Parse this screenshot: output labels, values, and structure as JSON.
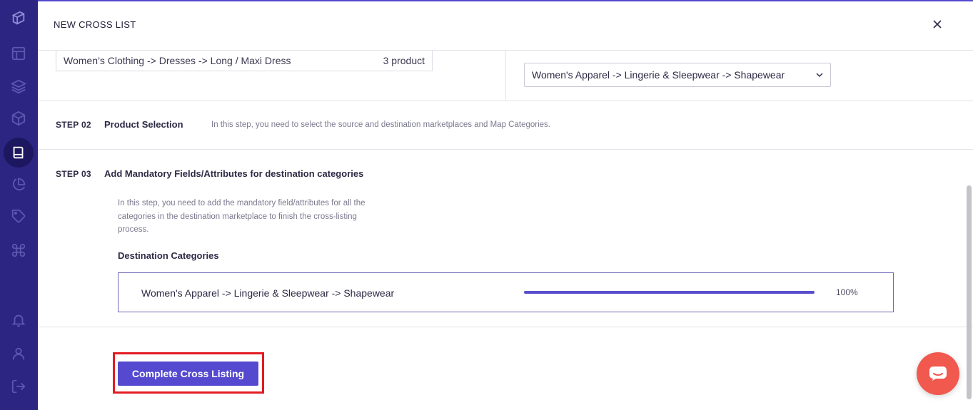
{
  "colors": {
    "sidebar": "#2c2582",
    "accent": "#5449cf",
    "highlight": "#e31b23",
    "chat": "#f1584e"
  },
  "sidebar": {
    "icons": [
      "logo-icon",
      "layout-icon",
      "layers-icon",
      "box-icon",
      "book-icon",
      "pie-chart-icon",
      "tag-icon",
      "command-icon",
      "bell-icon",
      "user-icon",
      "logout-icon"
    ],
    "active": "book-icon"
  },
  "header": {
    "title": "NEW CROSS LIST",
    "close_icon": "close-icon"
  },
  "step1": {
    "source_category": "Women’s Clothing -> Dresses -> Long / Maxi Dress",
    "source_count": "3 product",
    "destination_selected": "Women's Apparel -> Lingerie & Sleepwear -> Shapewear"
  },
  "step2": {
    "number": "STEP 02",
    "title": "Product Selection",
    "description": "In this step, you need to select the source and destination marketplaces and Map Categories."
  },
  "step3": {
    "number": "STEP 03",
    "title": "Add Mandatory Fields/Attributes for destination categories",
    "description_lines": [
      "In this step, you need to add the mandatory field/attributes for all the",
      "categories in the destination marketplace to finish the cross-listing",
      "process."
    ],
    "destination_label": "Destination Categories",
    "destination_category": "Women's Apparel -> Lingerie & Sleepwear -> Shapewear",
    "progress_percent": 100,
    "progress_label": "100%"
  },
  "actions": {
    "complete_label": "Complete Cross Listing"
  },
  "chat": {
    "icon": "chat-icon"
  }
}
